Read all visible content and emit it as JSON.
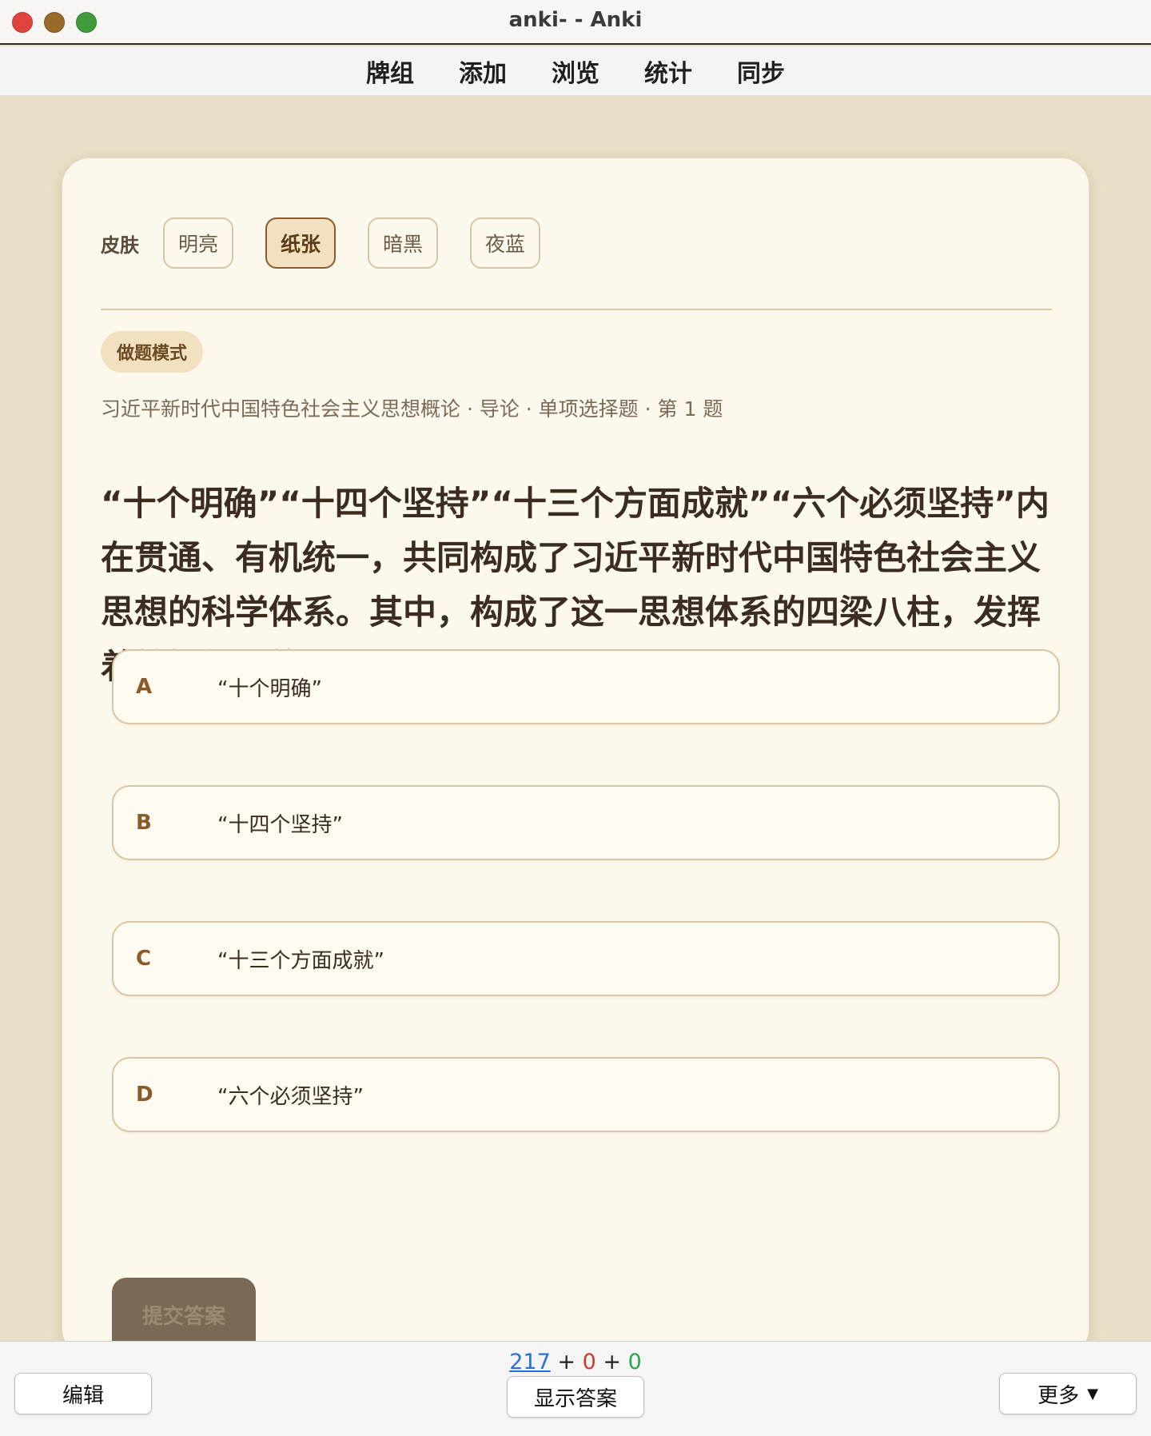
{
  "window": {
    "title": "anki- - Anki"
  },
  "toolbar": {
    "items": [
      "牌组",
      "添加",
      "浏览",
      "统计",
      "同步"
    ]
  },
  "skin": {
    "label": "皮肤",
    "options": [
      "明亮",
      "纸张",
      "暗黑",
      "夜蓝"
    ],
    "selected": "纸张"
  },
  "mode_badge": "做题模式",
  "breadcrumb": "习近平新时代中国特色社会主义思想概论 · 导论 · 单项选择题 · 第 1 题",
  "question": "“十个明确”“十四个坚持”“十三个方面成就”“六个必须坚持”内在贯通、有机统一，共同构成了习近平新时代中国特色社会主义思想的科学体系。其中，构成了这一思想体系的四梁八柱，发挥着统摄作用的是",
  "options": [
    {
      "letter": "A",
      "text": "“十个明确”"
    },
    {
      "letter": "B",
      "text": "“十四个坚持”"
    },
    {
      "letter": "C",
      "text": "“十三个方面成就”"
    },
    {
      "letter": "D",
      "text": "“六个必须坚持”"
    }
  ],
  "submit_label": "提交答案",
  "bottom": {
    "counts": {
      "new": "217",
      "learn": "0",
      "review": "0",
      "sep": "+"
    },
    "edit_label": "编辑",
    "show_answer_label": "显示答案",
    "more_label": "更多"
  },
  "colors": {
    "background": "#e9dfc8",
    "card": "#fdf8ec",
    "accent": "#8a5a2a",
    "new_count": "#2a6fd6",
    "learn_count": "#d33a2e",
    "review_count": "#2ba44a"
  }
}
